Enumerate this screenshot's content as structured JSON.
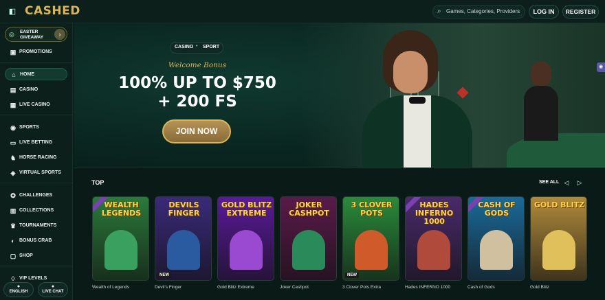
{
  "header": {
    "logo": "CASHED",
    "search_placeholder": "Games, Categories, Providers",
    "login_label": "LOG IN",
    "register_label": "REGISTER"
  },
  "sidebar": {
    "easter_label": "EASTER GIVEAWAY",
    "items": [
      {
        "label": "PROMOTIONS",
        "icon": "gift-icon"
      },
      {
        "label": "HOME",
        "icon": "home-icon"
      },
      {
        "label": "CASINO",
        "icon": "cards-icon"
      },
      {
        "label": "LIVE CASINO",
        "icon": "live-icon"
      },
      {
        "label": "SPORTS",
        "icon": "ball-icon"
      },
      {
        "label": "LIVE BETTING",
        "icon": "live-betting-icon"
      },
      {
        "label": "HORSE RACING",
        "icon": "horse-icon"
      },
      {
        "label": "VIRTUAL SPORTS",
        "icon": "virtual-icon"
      },
      {
        "label": "CHALLENGES",
        "icon": "challenge-icon"
      },
      {
        "label": "COLLECTIONS",
        "icon": "collection-icon"
      },
      {
        "label": "TOURNAMENTS",
        "icon": "trophy-icon"
      },
      {
        "label": "BONUS CRAB",
        "icon": "crab-icon"
      },
      {
        "label": "SHOP",
        "icon": "shop-icon"
      },
      {
        "label": "VIP LEVELS",
        "icon": "vip-icon"
      }
    ],
    "language_label": "ENGLISH",
    "live_chat_label": "LIVE CHAT"
  },
  "banner": {
    "tab_casino": "CASINO",
    "tab_sport": "SPORT",
    "welcome": "Welcome Bonus",
    "headline_line1": "100% UP TO $750",
    "headline_line2": "+ 200 FS",
    "cta": "JOIN NOW"
  },
  "top": {
    "title": "TOP",
    "see_all": "SEE ALL",
    "games": [
      {
        "name": "Wealth of Legends",
        "art": "WEALTH LEGENDS",
        "bg": "#2a7a3a",
        "fig": "#3aa060",
        "new": false,
        "exclusive": true
      },
      {
        "name": "Devil's Finger",
        "art": "DEVILS FINGER",
        "bg": "#3a2a7a",
        "fig": "#2a5aa0",
        "new": true,
        "exclusive": false
      },
      {
        "name": "Gold Blitz Extreme",
        "art": "GOLD BLITZ EXTREME",
        "bg": "#5a1a9a",
        "fig": "#9a4ad0",
        "new": false,
        "exclusive": false
      },
      {
        "name": "Joker Cashpot",
        "art": "JOKER CASHPOT",
        "bg": "#5a1a4a",
        "fig": "#2a8a5a",
        "new": false,
        "exclusive": false
      },
      {
        "name": "3 Clover Pots Extra",
        "art": "3 CLOVER POTS",
        "bg": "#2a8a3a",
        "fig": "#d05a2a",
        "new": true,
        "exclusive": false
      },
      {
        "name": "Hades INFERNO 1000",
        "art": "HADES INFERNO 1000",
        "bg": "#4a2a6a",
        "fig": "#b04a3a",
        "new": false,
        "exclusive": true
      },
      {
        "name": "Cash of Gods",
        "art": "CASH OF GODS",
        "bg": "#1a6a9a",
        "fig": "#d0c0a0",
        "new": false,
        "exclusive": true
      },
      {
        "name": "Gold Blitz",
        "art": "GOLD BLITZ",
        "bg": "#b08a3a",
        "fig": "#e0c05a",
        "new": false,
        "exclusive": false
      }
    ]
  }
}
